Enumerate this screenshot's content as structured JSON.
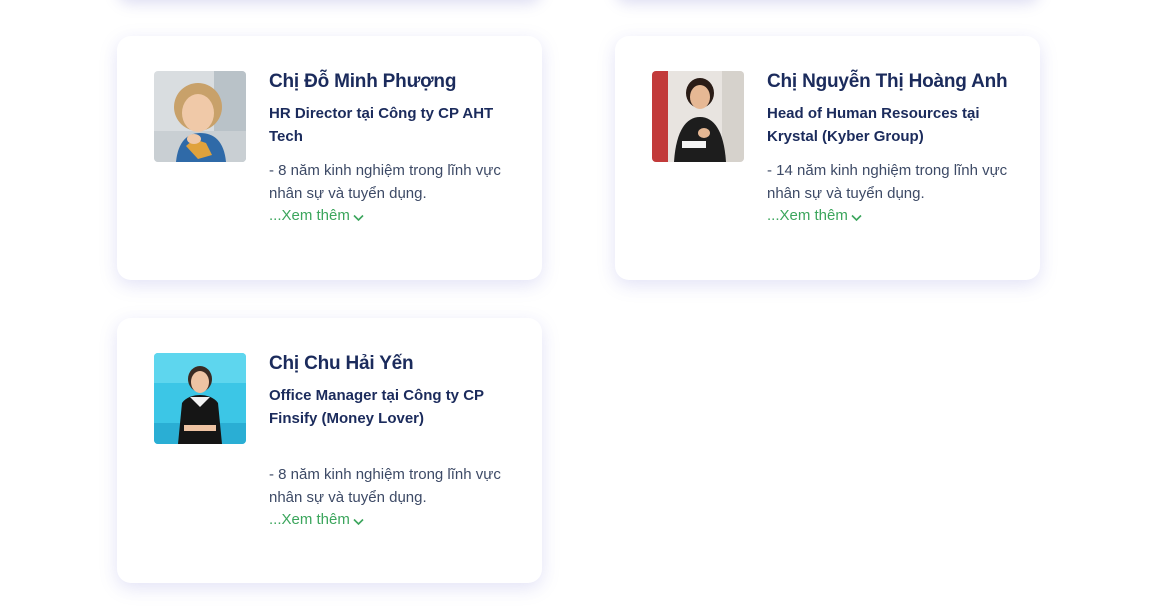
{
  "colors": {
    "name": "#1b2b5c",
    "text": "#3d4a66",
    "link": "#3ba55c",
    "card_bg": "#ffffff"
  },
  "speakers": [
    {
      "name": "Chị Đỗ Minh Phượng",
      "title": "HR Director tại Công ty CP AHT Tech",
      "description": "- 8 năm kinh nghiệm trong lĩnh vực nhân sự và tuyển dụng.",
      "more_label": "...Xem thêm",
      "avatar_icon": "portrait-photo-icon"
    },
    {
      "name": "Chị Nguyễn Thị Hoàng Anh",
      "title": "Head of Human Resources tại Krystal (Kyber Group)",
      "description": "- 14 năm kinh nghiệm trong lĩnh vực nhân sự và tuyển dụng.",
      "more_label": "...Xem thêm",
      "avatar_icon": "portrait-photo-icon"
    },
    {
      "name": "Chị Chu Hải Yến",
      "title": "Office Manager tại Công ty CP Finsify (Money Lover)",
      "description": "- 8 năm kinh nghiệm trong lĩnh vực nhân sự và tuyển dụng.",
      "more_label": "...Xem thêm",
      "avatar_icon": "portrait-photo-icon"
    }
  ]
}
